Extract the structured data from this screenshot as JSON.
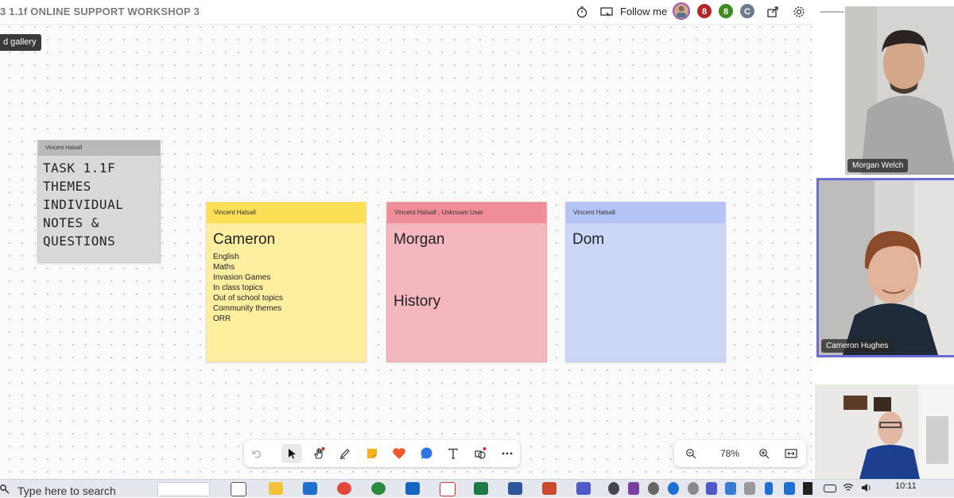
{
  "header": {
    "title": "3  1.1f ONLINE SUPPORT WORKSHOP 3",
    "follow_me": "Follow me",
    "avatars": [
      {
        "label": "8",
        "color": "#b5262c"
      },
      {
        "label": "8",
        "color": "#3d8b1f"
      },
      {
        "label": "C",
        "color": "#6b7c8c"
      }
    ]
  },
  "tooltip": "d gallery",
  "notes": {
    "task": {
      "author": "Vincent Halsall",
      "lines": [
        "TASK 1.1F",
        "THEMES",
        "INDIVIDUAL",
        "NOTES &",
        "QUESTIONS"
      ],
      "color": "#d8d8d8"
    },
    "cameron": {
      "author": "Vincent Halsall",
      "title": "Cameron",
      "items": [
        "English",
        "Maths",
        "Invasion Games",
        "In class topics",
        "Out of school topics",
        "Community themes",
        "ORR"
      ],
      "color": "#fdeea0"
    },
    "morgan": {
      "author": "Vincent Halsall , Unknown User",
      "title": "Morgan",
      "subtitle": "History",
      "color": "#f4b7bd"
    },
    "dom": {
      "author": "Vincent Halsall",
      "title": "Dom",
      "color": "#ccd7f8"
    }
  },
  "toolbar": {
    "tools": [
      "undo-icon",
      "select-icon",
      "hand-icon",
      "pen-icon",
      "sticky-note-icon",
      "reaction-icon",
      "comment-icon",
      "text-icon",
      "shapes-icon",
      "more-icon"
    ]
  },
  "zoom": {
    "value": "78%"
  },
  "participants": [
    {
      "name": "Morgan Welch"
    },
    {
      "name": "Cameron Hughes"
    },
    {
      "name": ""
    }
  ],
  "taskbar": {
    "search_placeholder": "Type here to search",
    "time": "10:11"
  }
}
